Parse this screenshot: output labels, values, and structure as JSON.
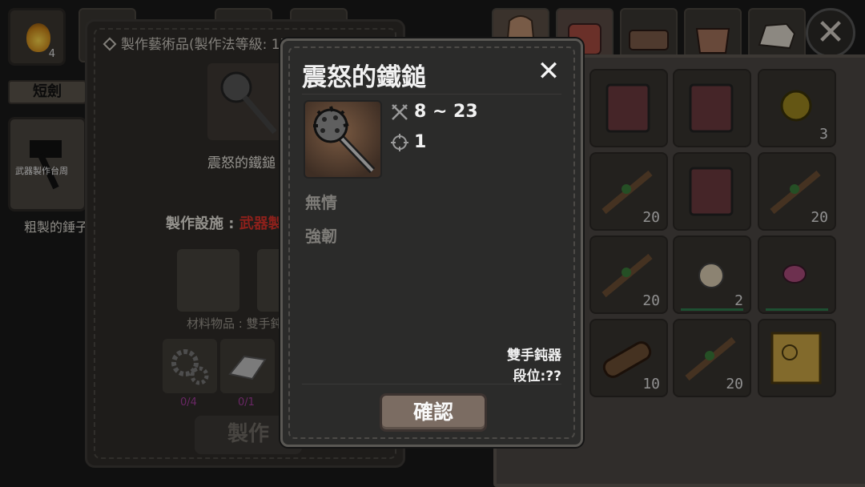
{
  "hud": {
    "fire_count": "4"
  },
  "sidebar": {
    "tab_label": "短劍",
    "recipe_card_label": "武器製作台周",
    "recipe_name": "粗製的錘子"
  },
  "craft": {
    "title": "製作藝術品(製作法等級: 1)",
    "item_name": "震怒的鐵鎚",
    "facility_label": "製作設施 : ",
    "facility_value": "武器製",
    "materials_label": "材料物品 : 雙手鈍",
    "ingredients": [
      {
        "name": "gear-icon",
        "count": "0/4"
      },
      {
        "name": "ingot-icon",
        "count": "0/1"
      }
    ],
    "craft_button": "製作"
  },
  "inventory": {
    "slots": [
      {
        "icon": "red-book-icon",
        "count": ""
      },
      {
        "icon": "red-book-icon",
        "count": ""
      },
      {
        "icon": "gold-coin-icon",
        "count": "3"
      },
      {
        "icon": "branch-icon",
        "count": "20"
      },
      {
        "icon": "red-book-icon",
        "count": ""
      },
      {
        "icon": "branch-icon",
        "count": "20"
      },
      {
        "icon": "branch-icon",
        "count": "20"
      },
      {
        "icon": "garlic-icon",
        "count": "2"
      },
      {
        "icon": "meat-icon",
        "count": ""
      },
      {
        "icon": "log-icon",
        "count": "10"
      },
      {
        "icon": "branch-icon",
        "count": "20"
      },
      {
        "icon": "treasure-map-icon",
        "count": ""
      }
    ]
  },
  "modal": {
    "title": "震怒的鐵鎚",
    "damage": "8 ~ 23",
    "range": "1",
    "traits": [
      "無情",
      "強韌"
    ],
    "weapon_type": "雙手鈍器",
    "rank": "段位:??",
    "confirm_label": "確認",
    "close_symbol": "✕"
  },
  "colors": {
    "accent_red": "#d8322a",
    "modal_bg": "#2b2b2a",
    "confirm_btn": "#7b6c62"
  }
}
